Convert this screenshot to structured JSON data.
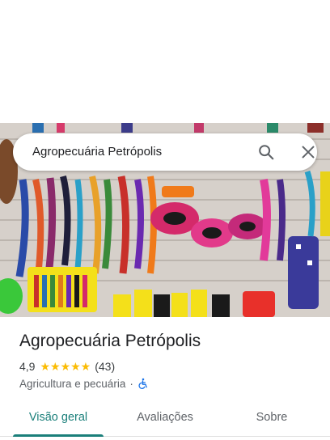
{
  "search": {
    "value": "Agropecuária Petrópolis"
  },
  "place": {
    "title": "Agropecuária Petrópolis",
    "rating": "4,9",
    "stars": "★★★★★",
    "review_count": "(43)",
    "category": "Agricultura e pecuária",
    "separator": "·"
  },
  "tabs": [
    {
      "label": "Visão geral"
    },
    {
      "label": "Avaliações"
    },
    {
      "label": "Sobre"
    }
  ],
  "icons": {
    "search": "search-icon",
    "close": "close-icon",
    "accessibility": "wheelchair-icon"
  },
  "colors": {
    "accent": "#1a7f7a",
    "star": "#fbbc04",
    "accessibility": "#1a73e8"
  }
}
